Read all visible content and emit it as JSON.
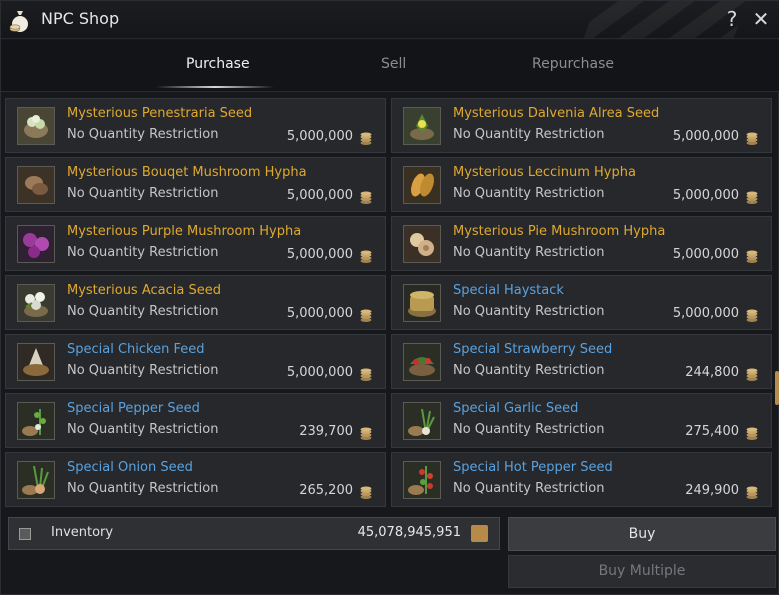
{
  "window": {
    "title": "NPC Shop",
    "help": "?",
    "close": "✕"
  },
  "tabs": [
    {
      "label": "Purchase",
      "active": true
    },
    {
      "label": "Sell",
      "active": false
    },
    {
      "label": "Repurchase",
      "active": false
    }
  ],
  "items": [
    {
      "name": "Mysterious Penestraria Seed",
      "restriction": "No Quantity Restriction",
      "price": "5,000,000",
      "name_color": "#e0a92e",
      "icon": "penestraria-seed-icon"
    },
    {
      "name": "Mysterious Dalvenia Alrea Seed",
      "restriction": "No Quantity Restriction",
      "price": "5,000,000",
      "name_color": "#e0a92e",
      "icon": "dalvenia-seed-icon"
    },
    {
      "name": "Mysterious Bouqet Mushroom Hypha",
      "restriction": "No Quantity Restriction",
      "price": "5,000,000",
      "name_color": "#e0a92e",
      "icon": "bouqet-mushroom-icon"
    },
    {
      "name": "Mysterious Leccinum Hypha",
      "restriction": "No Quantity Restriction",
      "price": "5,000,000",
      "name_color": "#e0a92e",
      "icon": "leccinum-icon"
    },
    {
      "name": "Mysterious Purple Mushroom Hypha",
      "restriction": "No Quantity Restriction",
      "price": "5,000,000",
      "name_color": "#e0a92e",
      "icon": "purple-mushroom-icon"
    },
    {
      "name": "Mysterious Pie Mushroom Hypha",
      "restriction": "No Quantity Restriction",
      "price": "5,000,000",
      "name_color": "#e0a92e",
      "icon": "pie-mushroom-icon"
    },
    {
      "name": "Mysterious Acacia Seed",
      "restriction": "No Quantity Restriction",
      "price": "5,000,000",
      "name_color": "#e0a92e",
      "icon": "acacia-seed-icon"
    },
    {
      "name": "Special Haystack",
      "restriction": "No Quantity Restriction",
      "price": "5,000,000",
      "name_color": "#5aa2df",
      "icon": "haystack-icon"
    },
    {
      "name": "Special Chicken Feed",
      "restriction": "No Quantity Restriction",
      "price": "5,000,000",
      "name_color": "#5aa2df",
      "icon": "chicken-feed-icon"
    },
    {
      "name": "Special Strawberry Seed",
      "restriction": "No Quantity Restriction",
      "price": "244,800",
      "name_color": "#5aa2df",
      "icon": "strawberry-seed-icon"
    },
    {
      "name": "Special Pepper Seed",
      "restriction": "No Quantity Restriction",
      "price": "239,700",
      "name_color": "#5aa2df",
      "icon": "pepper-seed-icon"
    },
    {
      "name": "Special Garlic Seed",
      "restriction": "No Quantity Restriction",
      "price": "275,400",
      "name_color": "#5aa2df",
      "icon": "garlic-seed-icon"
    },
    {
      "name": "Special Onion Seed",
      "restriction": "No Quantity Restriction",
      "price": "265,200",
      "name_color": "#5aa2df",
      "icon": "onion-seed-icon"
    },
    {
      "name": "Special Hot Pepper Seed",
      "restriction": "No Quantity Restriction",
      "price": "249,900",
      "name_color": "#5aa2df",
      "icon": "hot-pepper-seed-icon"
    }
  ],
  "inventory": {
    "label": "Inventory",
    "value": "45,078,945,951"
  },
  "buttons": {
    "buy": "Buy",
    "buy_multiple": "Buy Multiple"
  }
}
